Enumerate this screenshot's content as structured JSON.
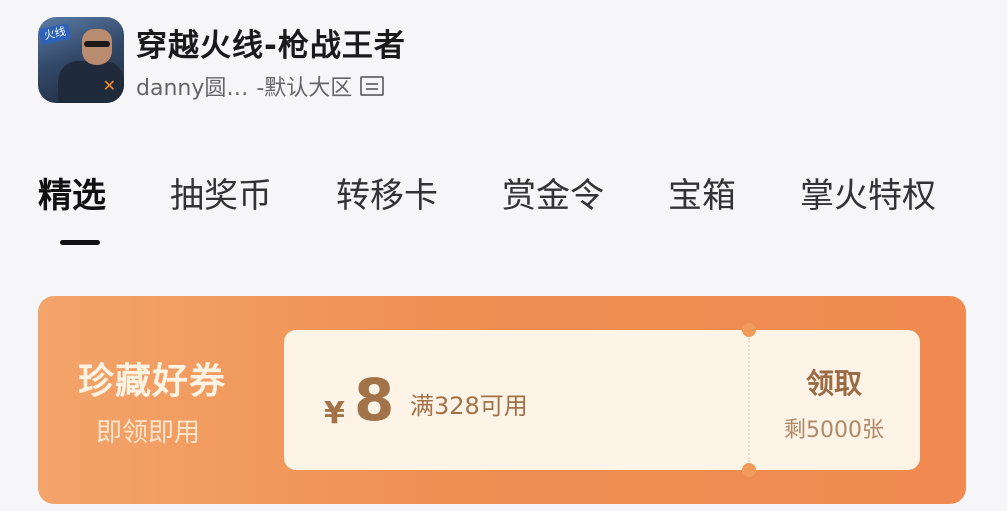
{
  "header": {
    "app_icon_badge": "火线",
    "app_title": "穿越火线-枪战王者",
    "user_name": "danny圆…",
    "server": "-默认大区"
  },
  "tabs": [
    {
      "label": "精选",
      "active": true
    },
    {
      "label": "抽奖币"
    },
    {
      "label": "转移卡"
    },
    {
      "label": "赏金令"
    },
    {
      "label": "宝箱"
    },
    {
      "label": "掌火特权"
    }
  ],
  "coupon_banner": {
    "title": "珍藏好券",
    "subtitle": "即领即用",
    "currency_symbol": "¥",
    "amount": "8",
    "condition": "满328可用",
    "claim_label": "领取",
    "remaining": "剩5000张"
  }
}
